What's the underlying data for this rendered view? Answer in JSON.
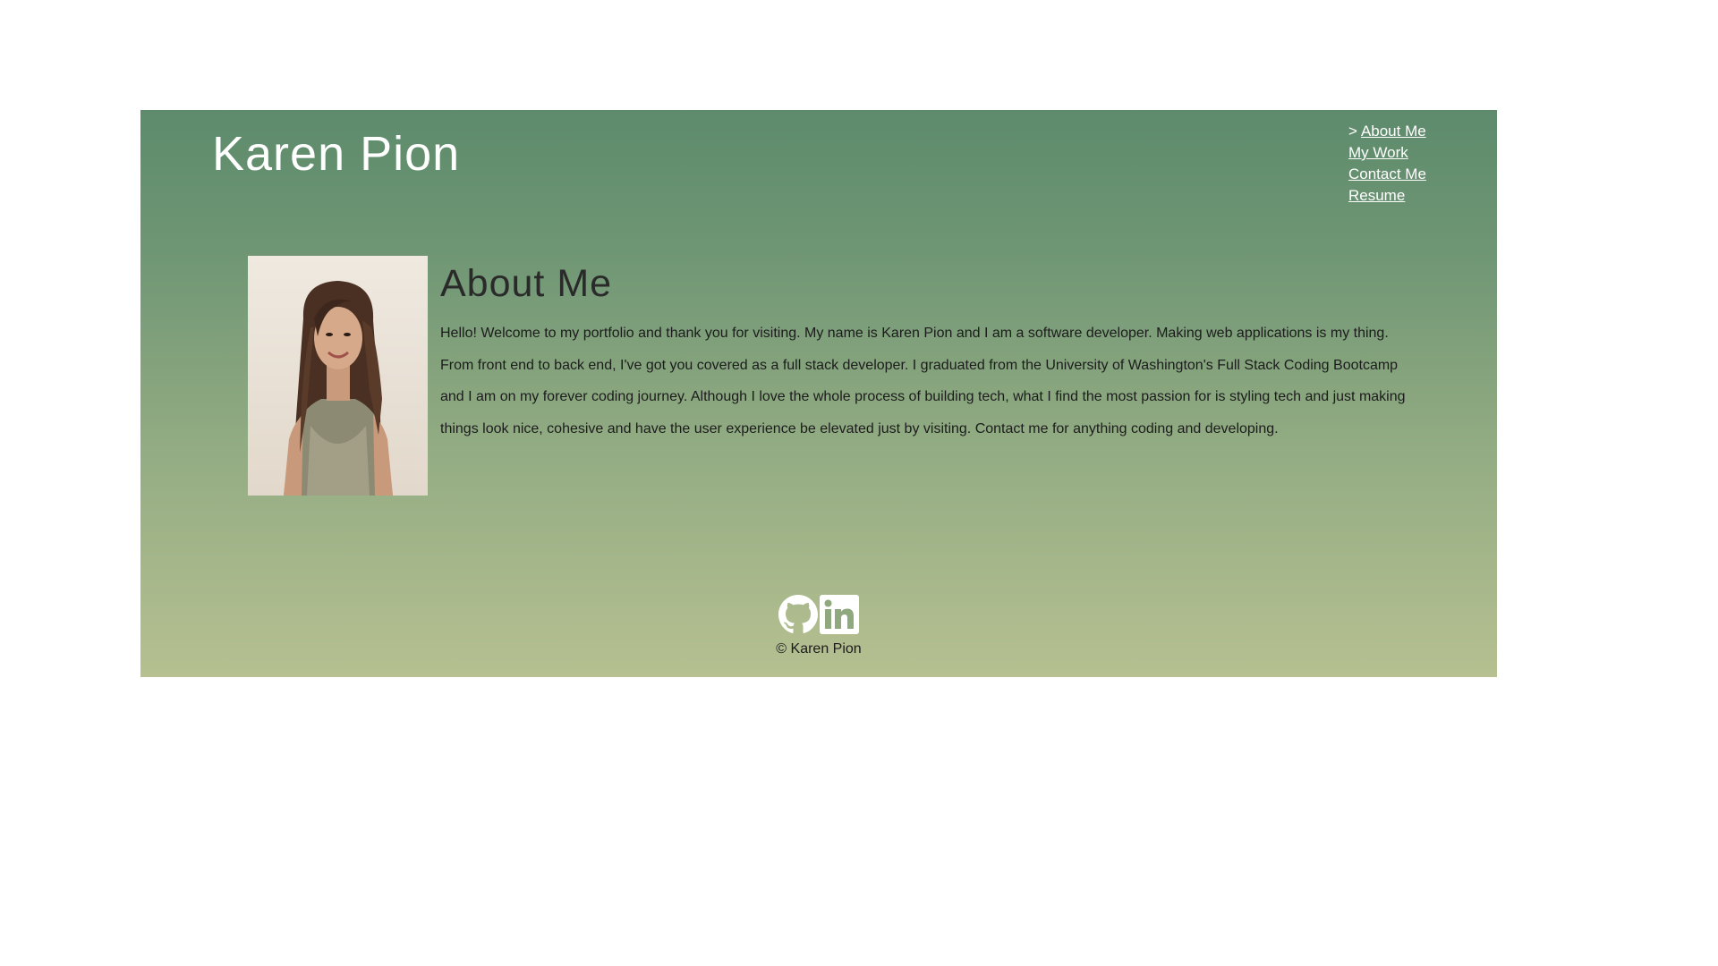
{
  "header": {
    "title": "Karen Pion"
  },
  "nav": {
    "active_marker": ">",
    "items": [
      {
        "label": "About Me",
        "active": true
      },
      {
        "label": "My Work",
        "active": false
      },
      {
        "label": "Contact Me",
        "active": false
      },
      {
        "label": "Resume",
        "active": false
      }
    ]
  },
  "about": {
    "heading": "About Me",
    "text": "Hello! Welcome to my portfolio and thank you for visiting. My name is Karen Pion and I am a software developer. Making web applications is my thing. From front end to back end, I've got you covered as a full stack developer. I graduated from the University of Washington's Full Stack Coding Bootcamp and I am on my forever coding journey. Although I love the whole process of building tech, what I find the most passion for is styling tech and just making things look nice, cohesive and have the user experience be elevated just by visiting. Contact me for anything coding and developing."
  },
  "footer": {
    "icons": [
      "github-icon",
      "linkedin-icon"
    ],
    "copyright": "© Karen Pion"
  },
  "colors": {
    "gradient_top": "#5d8b6c",
    "gradient_bottom": "#b6c091",
    "title_text": "#ffffff",
    "body_text": "#1c1c1c"
  }
}
